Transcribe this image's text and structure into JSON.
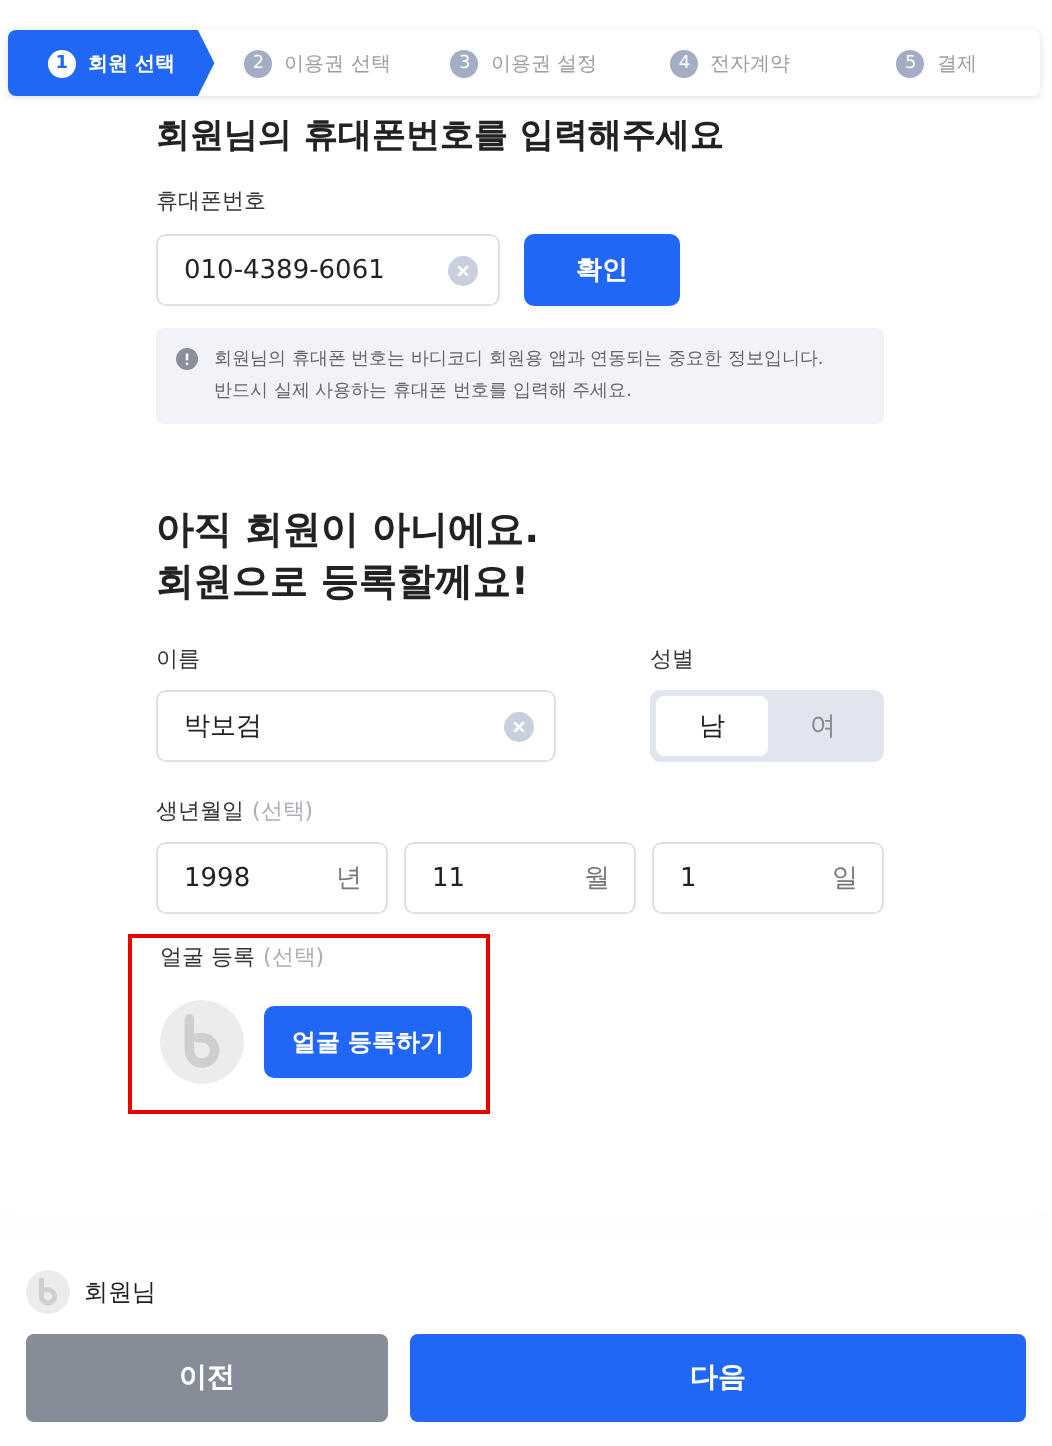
{
  "steps": [
    {
      "number": "1",
      "label": "회원 선택",
      "selected": true
    },
    {
      "number": "2",
      "label": "이용권 선택",
      "selected": false
    },
    {
      "number": "3",
      "label": "이용권 설정",
      "selected": false
    },
    {
      "number": "4",
      "label": "전자계약",
      "selected": false
    },
    {
      "number": "5",
      "label": "결제",
      "selected": false
    }
  ],
  "phone_section": {
    "title": "회원님의 휴대폰번호를 입력해주세요",
    "label": "휴대폰번호",
    "value": "010-4389-6061",
    "button": "확인",
    "notice_lines": [
      "회원님의 휴대폰 번호는 바디코디 회원용 앱과 연동되는 중요한 정보입니다.",
      "반드시 실제 사용하는 휴대폰 번호를 입력해 주세요."
    ]
  },
  "register_section": {
    "heading_lines": [
      "아직 회원이 아니에요.",
      "회원으로 등록할께요!"
    ],
    "name": {
      "label": "이름",
      "value": "박보검"
    },
    "gender": {
      "label": "성별",
      "options": [
        {
          "label": "남",
          "selected": true
        },
        {
          "label": "여",
          "selected": false
        }
      ]
    },
    "birth": {
      "label": "생년월일",
      "optional": "(선택)",
      "fields": [
        {
          "value": "1998",
          "unit": "년"
        },
        {
          "value": "11",
          "unit": "월"
        },
        {
          "value": "1",
          "unit": "일"
        }
      ]
    },
    "face": {
      "label": "얼굴 등록",
      "optional": "(선택)",
      "button": "얼굴 등록하기",
      "highlighted": true
    }
  },
  "footer": {
    "member": "회원님",
    "buttons": [
      {
        "label": "이전",
        "kind": "secondary"
      },
      {
        "label": "다음",
        "kind": "primary"
      }
    ]
  }
}
